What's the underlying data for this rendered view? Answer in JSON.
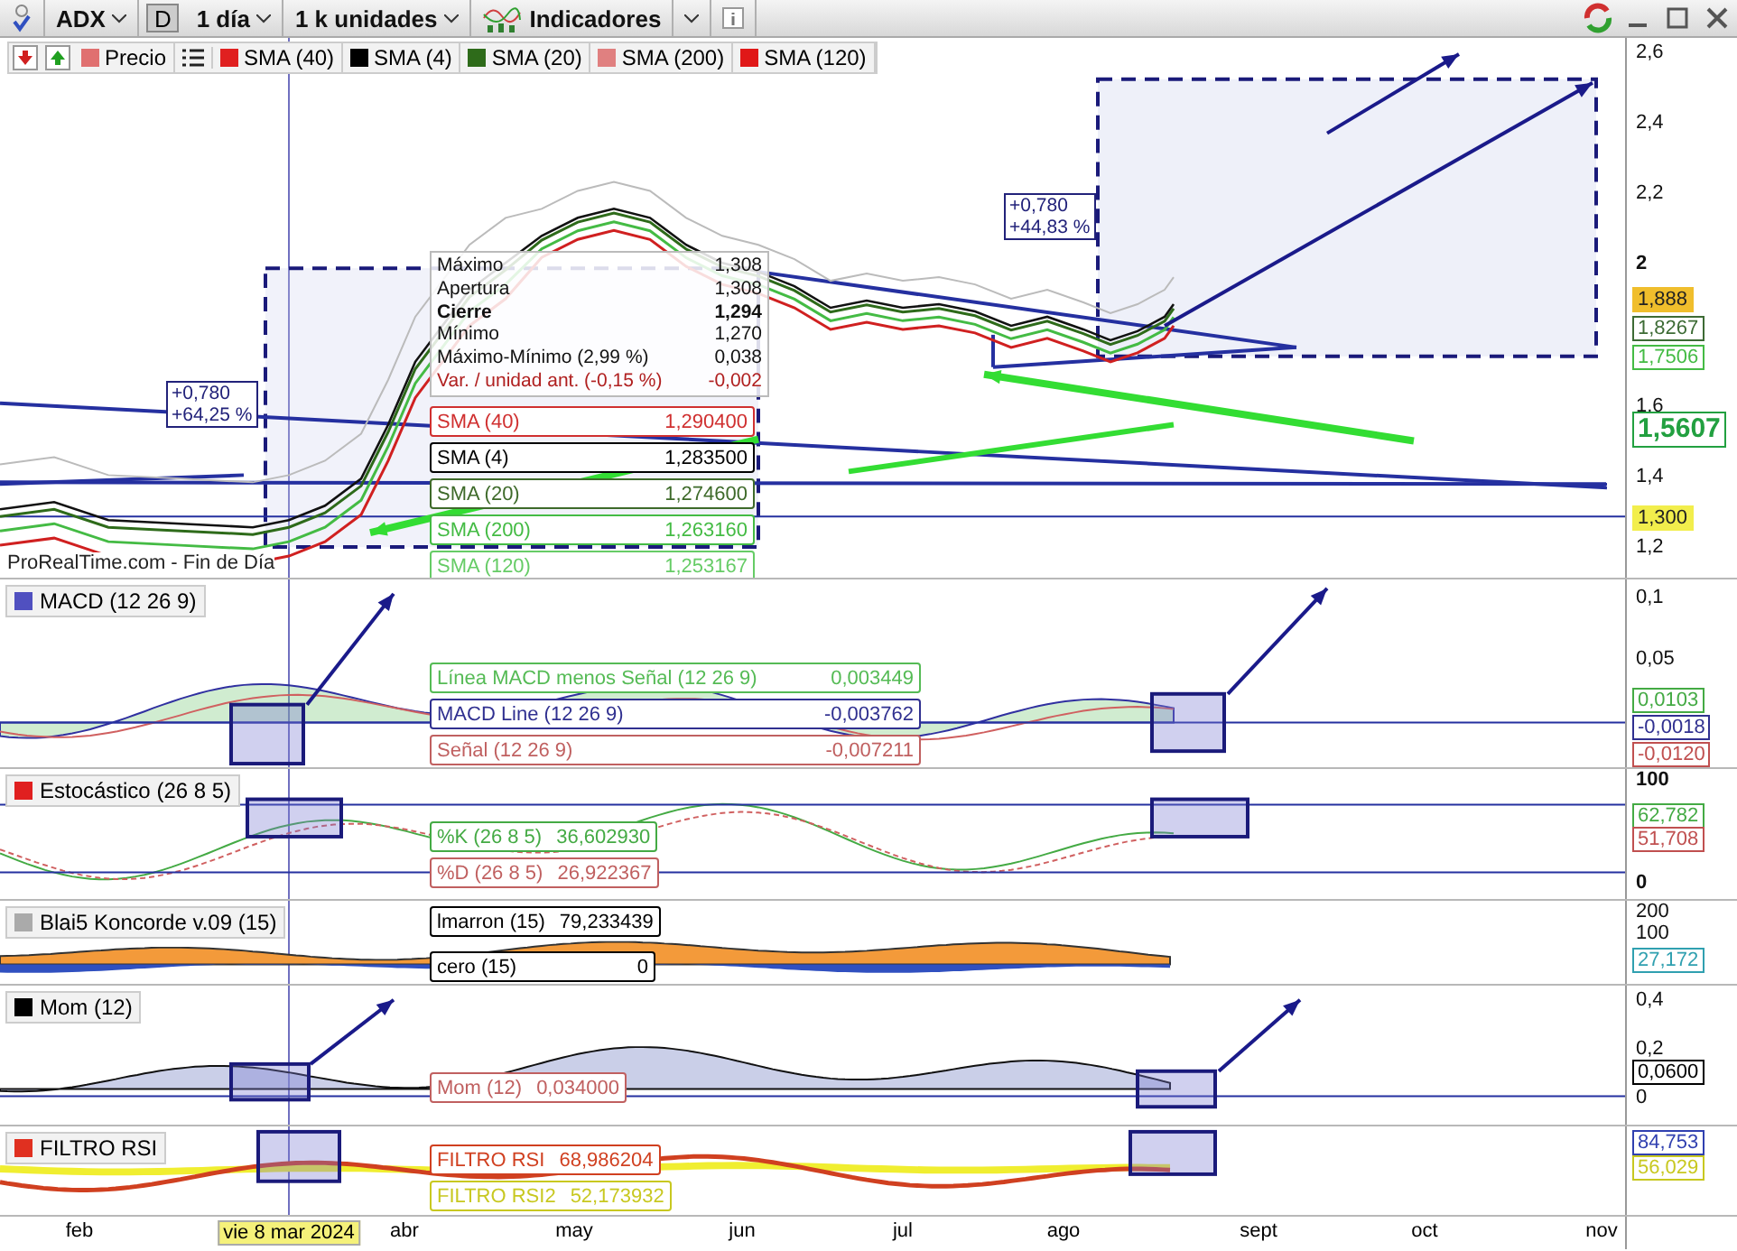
{
  "toolbar": {
    "symbol": "ADX",
    "period_badge": "D",
    "timeframe": "1 día",
    "units": "1 k unidades",
    "indicators": "Indicadores"
  },
  "legend": {
    "items": [
      {
        "label": "Precio",
        "color": "#e07070"
      },
      {
        "label": "SMA (40)",
        "color": "#e02020"
      },
      {
        "label": "SMA (4)",
        "color": "#000000"
      },
      {
        "label": "SMA (20)",
        "color": "#2e6b1a"
      },
      {
        "label": "SMA (200)",
        "color": "#e08080"
      },
      {
        "label": "SMA (120)",
        "color": "#e01818"
      }
    ]
  },
  "price_panel": {
    "source": "ProRealTime.com - Fin de Día",
    "info_rows": [
      {
        "label": "Máximo",
        "value": "1,308",
        "kind": "normal"
      },
      {
        "label": "Apertura",
        "value": "1,308",
        "kind": "normal"
      },
      {
        "label": "Cierre",
        "value": "1,294",
        "kind": "bold"
      },
      {
        "label": "Mínimo",
        "value": "1,270",
        "kind": "normal"
      },
      {
        "label": "Máximo-Mínimo (2,99 %)",
        "value": "0,038",
        "kind": "normal"
      },
      {
        "label": "Var. / unidad ant. (-0,15 %)",
        "value": "-0,002",
        "kind": "negative"
      }
    ],
    "tags": [
      {
        "label": "SMA (40)",
        "value": "1,290400",
        "color": "#d03030"
      },
      {
        "label": "SMA (4)",
        "value": "1,283500",
        "color": "#000000"
      },
      {
        "label": "SMA (20)",
        "value": "1,274600",
        "color": "#3e6a2a"
      },
      {
        "label": "SMA (200)",
        "value": "1,263160",
        "color": "#44bb44"
      },
      {
        "label": "SMA (120)",
        "value": "1,253167",
        "color": "#66cc66"
      }
    ],
    "change_boxes": [
      {
        "lines": [
          "+0,780",
          "+64,25 %"
        ]
      },
      {
        "lines": [
          "+0,780",
          "+44,83 %"
        ]
      }
    ],
    "y_ticks": [
      "2,6",
      "2,4",
      "2,2",
      "2",
      "1,6",
      "1,4",
      "1,2"
    ],
    "price_tags": [
      {
        "text": "1,888",
        "kind": "filled",
        "color": "#f0be2c"
      },
      {
        "text": "1,8267",
        "kind": "outlined",
        "color": "#3d6b35"
      },
      {
        "text": "1,7506",
        "kind": "outlined",
        "color": "#44bb44"
      },
      {
        "text": "1,5607",
        "kind": "large",
        "color": "#22a040"
      },
      {
        "text": "1,300",
        "kind": "filled",
        "color": "#f2ee4c"
      }
    ]
  },
  "indicator_panels": [
    {
      "title": "MACD (12 26 9)",
      "color": "#5050c0",
      "tags": [
        {
          "label": "Línea MACD menos Señal (12 26 9)",
          "value": "0,003449",
          "color": "#55bb55"
        },
        {
          "label": "MACD Line (12 26 9)",
          "value": "-0,003762",
          "color": "#303090"
        },
        {
          "label": "Señal (12 26 9)",
          "value": "-0,007211",
          "color": "#c06060"
        }
      ],
      "y_ticks": [
        "0,1",
        "0,05"
      ],
      "value_tags": [
        {
          "text": "0,0103",
          "color": "#44aa44"
        },
        {
          "text": "-0,0018",
          "color": "#303090"
        },
        {
          "text": "-0,0120",
          "color": "#c05050"
        }
      ]
    },
    {
      "title": "Estocástico (26 8 5)",
      "color": "#e02020",
      "tags": [
        {
          "label": "%K (26 8 5)",
          "value": "36,602930",
          "color": "#44aa44"
        },
        {
          "label": "%D (26 8 5)",
          "value": "26,922367",
          "color": "#c06060"
        }
      ],
      "y_ticks": [
        "100",
        "0"
      ],
      "value_tags": [
        {
          "text": "62,782",
          "color": "#44aa44"
        },
        {
          "text": "51,708",
          "color": "#c05050"
        }
      ]
    },
    {
      "title": "Blai5 Koncorde v.09 (15)",
      "color": "#aaaaaa",
      "tags": [
        {
          "label": "lmarron (15)",
          "value": "79,233439",
          "color": "#000000"
        },
        {
          "label": "cero (15)",
          "value": "0",
          "color": "#000000"
        }
      ],
      "y_ticks": [
        "200",
        "100"
      ],
      "value_tags": [
        {
          "text": "27,172",
          "color": "#30a0b0"
        }
      ]
    },
    {
      "title": "Mom (12)",
      "color": "#000000",
      "tags": [
        {
          "label": "Mom (12)",
          "value": "0,034000",
          "color": "#c06060"
        }
      ],
      "y_ticks": [
        "0,4",
        "0,2",
        "0"
      ],
      "value_tags": [
        {
          "text": "0,0600",
          "color": "#000000"
        }
      ]
    },
    {
      "title": "FILTRO RSI",
      "color": "#e03020",
      "tags": [
        {
          "label": "FILTRO RSI",
          "value": "68,986204",
          "color": "#d04020"
        },
        {
          "label": "FILTRO RSI2",
          "value": "52,173932",
          "color": "#c8c820"
        }
      ],
      "value_tags": [
        {
          "text": "84,753",
          "color": "#3040b0"
        },
        {
          "text": "56,029",
          "color": "#c8c820"
        }
      ]
    }
  ],
  "x_axis": {
    "labels": [
      {
        "text": "feb",
        "kind": "date"
      },
      {
        "text": "vie 8 mar 2024",
        "kind": "cursor"
      },
      {
        "text": "abr",
        "kind": "date"
      },
      {
        "text": "may",
        "kind": "date"
      },
      {
        "text": "jun",
        "kind": "date"
      },
      {
        "text": "jul",
        "kind": "date"
      },
      {
        "text": "ago",
        "kind": "date"
      },
      {
        "text": "sept",
        "kind": "date"
      },
      {
        "text": "oct",
        "kind": "date"
      },
      {
        "text": "nov",
        "kind": "date"
      }
    ]
  }
}
